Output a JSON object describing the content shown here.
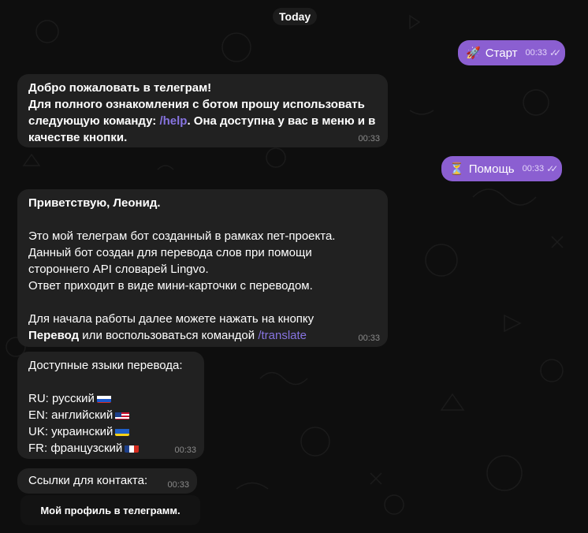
{
  "date_divider": "Today",
  "messages": {
    "start": {
      "text": "Старт",
      "time": "00:33",
      "icon": "rocket-icon",
      "emoji": "🚀"
    },
    "welcome": {
      "line1": "Добро пожаловать в телеграм!",
      "line2": "Для полного ознакомления с ботом прошу использовать",
      "line3_prefix": "следующую команду: ",
      "line3_cmd": "/help",
      "line3_suffix": ". Она доступна у вас в меню и в",
      "line4": "качестве кнопки.",
      "time": "00:33"
    },
    "help": {
      "text": "Помощь",
      "time": "00:33",
      "icon": "hourglass-icon",
      "emoji": "⏳"
    },
    "greeting": {
      "line1": "Приветствую, Леонид.",
      "line2": "Это мой телеграм бот созданный в рамках пет-проекта.",
      "line3": "Данный бот создан для перевода слов при помощи",
      "line4": "стороннего API словарей Lingvo.",
      "line5": "Ответ приходит в виде мини-карточки с переводом.",
      "line6": "Для начала работы далее можете нажать на кнопку",
      "line7_bold": "Перевод",
      "line7_mid": " или воспользоваться командой ",
      "line7_cmd": "/translate",
      "time": "00:33"
    },
    "languages": {
      "title": "Доступные языки перевода:",
      "items": [
        {
          "text": "RU: русский",
          "flag": "ru-flag"
        },
        {
          "text": "EN: английский",
          "flag": "us-flag"
        },
        {
          "text": "UK: украинский",
          "flag": "ua-flag"
        },
        {
          "text": "FR: французский",
          "flag": "fr-flag"
        }
      ],
      "time": "00:33"
    },
    "contacts": {
      "text": "Ссылки для контакта:",
      "time": "00:33"
    }
  },
  "inline_button": {
    "label": "Мой профиль в телеграмм."
  },
  "colors": {
    "background": "#0e0e0e",
    "incoming_bubble": "#212121",
    "outgoing_bubble": "#8b5fd1",
    "command_link": "#8774e1"
  }
}
